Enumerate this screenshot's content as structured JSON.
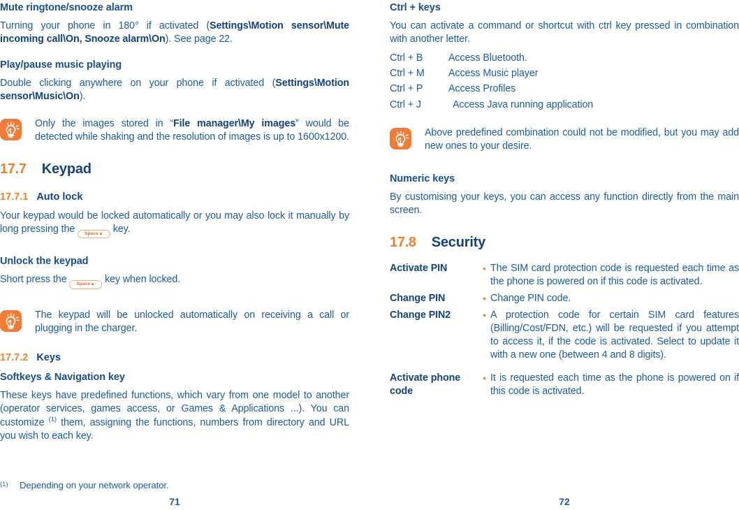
{
  "document": {
    "left_page_number": "71",
    "right_page_number": "72",
    "accent_orange": "#F07F28",
    "heading_blue": "#14427D",
    "body_blue": "#1B5C9E",
    "tip_icon_bg": "#F47B36"
  },
  "left": {
    "mute_heading": "Mute ringtone/snooze alarm",
    "mute_para_1": "Turning your phone in 180° if activated (",
    "mute_para_bold_1": "Settings\\Motion sensor\\Mute incoming call\\On, Snooze alarm\\On",
    "mute_para_2": "). See page 22.",
    "play_heading": "Play/pause music playing",
    "play_para_1": "Double clicking anywhere on your phone if activated (",
    "play_para_bold_1": "Settings\\Motion sensor\\Music\\On",
    "play_para_2": ").",
    "tip_1_text_1": "Only the images stored in “",
    "tip_1_bold": "File manager\\My images",
    "tip_1_text_2": "” would be detected while shaking and the resolution of images is up to 1600x1200.",
    "section_17_7_number": "17.7",
    "section_17_7_title": "Keypad",
    "sub_17_7_1_number": "17.7.1",
    "sub_17_7_1_title": "Auto lock",
    "autolock_para_1": "Your keypad would be locked automatically or you may also lock it manually by long pressing the",
    "space_key_label": "Space▲",
    "autolock_para_2": "key.",
    "unlock_heading": "Unlock the keypad",
    "unlock_para_1": "Short press the",
    "unlock_para_2": "key when locked.",
    "tip_2_text": "The keypad will be unlocked automatically on receiving a call or plugging in the charger.",
    "sub_17_7_2_number": "17.7.2",
    "sub_17_7_2_title": "Keys",
    "softkeys_heading": "Softkeys & Navigation key",
    "softkeys_para_a": "These keys have predefined functions, which vary from one model to another (operator services, games access, or Games & Applications ...). You can customize ",
    "softkeys_footnote_mark": "(1)",
    "softkeys_para_b": " them, assigning the functions, numbers from directory and URL you wish to each key.",
    "footnote_mark": "(1)",
    "footnote_text": "Depending on your network operator."
  },
  "right": {
    "ctrl_heading": "Ctrl + keys",
    "ctrl_para": "You can activate a command or shortcut with ctrl key pressed in combination with another letter.",
    "ctrl_rows": [
      {
        "key": "Ctrl + B",
        "desc": "Access Bluetooth."
      },
      {
        "key": "Ctrl + M",
        "desc": "Access Music player"
      },
      {
        "key": "Ctrl + P",
        "desc": "Access Profiles"
      },
      {
        "key": "Ctrl + J",
        "desc": "Access Java running application"
      }
    ],
    "tip_3_text": "Above predefined combination could not be modified, but you may add new ones to your desire.",
    "numeric_heading": "Numeric keys",
    "numeric_para": "By customising your keys, you can access any function directly from the main screen.",
    "section_17_8_number": "17.8",
    "section_17_8_title": "Security",
    "security_rows": [
      {
        "label": "Activate PIN",
        "desc": "The SIM card protection code is requested each time as the phone is powered on if this code is activated."
      },
      {
        "label": "Change PIN",
        "desc": "Change PIN code."
      },
      {
        "label": "Change PIN2",
        "desc": "A protection code for certain SIM card features (Billing/Cost/FDN, etc.) will be requested if you attempt to access it, if the code is activated. Select to update it with a new one (between 4 and 8 digits)."
      },
      {
        "label": "Activate phone code",
        "desc": "It is requested each time as the phone is powered on if this code is activated."
      }
    ]
  }
}
